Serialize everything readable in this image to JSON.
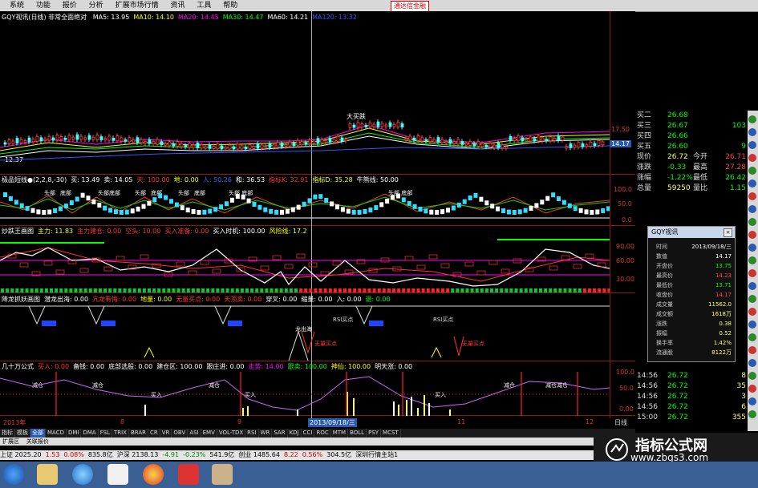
{
  "menu": {
    "items": [
      "系统",
      "功能",
      "报价",
      "分析",
      "扩展市场行情",
      "资讯",
      "工具",
      "帮助"
    ],
    "brand": "通达信金融"
  },
  "ma_panel": {
    "title": "GQY视讯(日线) 非常全面绝对",
    "labels": [
      {
        "text": "MA5: 13.95",
        "color": "#ffffff"
      },
      {
        "text": "MA10: 14.10",
        "color": "#ffff00"
      },
      {
        "text": "MA20: 14.45",
        "color": "#ff00ff"
      },
      {
        "text": "MA30: 14.47",
        "color": "#00ff00"
      },
      {
        "text": "MA60: 14.21",
        "color": "#ffffff"
      },
      {
        "text": "MA120: 13.32",
        "color": "#3355ff"
      }
    ],
    "price_low": "12.37",
    "price_mark": "17.50",
    "price_current": "14.17",
    "annot": "大买跌"
  },
  "panel2": {
    "labels": [
      {
        "text": "极品短线●(2,2,8,-30)",
        "color": "#ffffff"
      },
      {
        "text": "买: 13.49",
        "color": "#ffffff"
      },
      {
        "text": "卖: 14.05",
        "color": "#ffffff"
      },
      {
        "text": "天: 100.00",
        "color": "#ff3333"
      },
      {
        "text": "地: 0.00",
        "color": "#ffff00"
      },
      {
        "text": "人: 50.26",
        "color": "#3366ff"
      },
      {
        "text": "和: 36.53",
        "color": "#ffffff"
      },
      {
        "text": "指标K: 32.91",
        "color": "#ff3333"
      },
      {
        "text": "指标D: 35.28",
        "color": "#ffff00"
      },
      {
        "text": "牛熊线: 50.00",
        "color": "#ffffff"
      }
    ],
    "marks": [
      "头部",
      "底部",
      "头部底部",
      "头部",
      "底部",
      "头部",
      "底部",
      "头部 底部",
      "头部 底部"
    ],
    "axis": [
      "100.0",
      "50.0",
      "0.0"
    ]
  },
  "panel3": {
    "labels": [
      {
        "text": "炒跌王画图",
        "color": "#ffffff"
      },
      {
        "text": "主力: 11.83",
        "color": "#ffff00"
      },
      {
        "text": "主力建仓: 0.00",
        "color": "#ff3333"
      },
      {
        "text": "空头: 10.00",
        "color": "#ff3333"
      },
      {
        "text": "买入准备: 0.00",
        "color": "#ff3333"
      },
      {
        "text": "买入时机: 100.00",
        "color": "#ffffff"
      },
      {
        "text": "风险线: 17.2",
        "color": "#ffff00"
      }
    ],
    "axis": [
      "90.00",
      "60.00",
      "30.00"
    ]
  },
  "panel4": {
    "labels": [
      {
        "text": "降龙抓妖画图",
        "color": "#ffffff"
      },
      {
        "text": "潜龙出海: 0.00",
        "color": "#ffffff"
      },
      {
        "text": "亢龙有悔: 0.00",
        "color": "#ff3333"
      },
      {
        "text": "地量: 0.00",
        "color": "#ffff00"
      },
      {
        "text": "无量买点: 0.00",
        "color": "#ff3333"
      },
      {
        "text": "天顶卖: 0.00",
        "color": "#ff3333"
      },
      {
        "text": "穿叉: 0.00",
        "color": "#ffffff"
      },
      {
        "text": "缩量: 0.00",
        "color": "#ffffff"
      },
      {
        "text": "入: 0.00",
        "color": "#ffffff"
      },
      {
        "text": "退: 0.00",
        "color": "#00ff00"
      }
    ],
    "marks": [
      "龙出海",
      "RSI买点",
      "RSI买点",
      "无量买点",
      "无量买点"
    ]
  },
  "panel5": {
    "labels": [
      {
        "text": "几十万公式",
        "color": "#ffffff"
      },
      {
        "text": "买入: 0.00",
        "color": "#ff3333"
      },
      {
        "text": "备钱: 0.00",
        "color": "#ffffff"
      },
      {
        "text": "底部选股: 0.00",
        "color": "#ffffff"
      },
      {
        "text": "建仓区: 100.00",
        "color": "#ffffff"
      },
      {
        "text": "跟庄进: 0.00",
        "color": "#ffffff"
      },
      {
        "text": "走势: 14.00",
        "color": "#ff00ff"
      },
      {
        "text": "跟卖: 100.00",
        "color": "#00ff00"
      },
      {
        "text": "神仙: 100.00",
        "color": "#ffff00"
      },
      {
        "text": "明天涨: 0.00",
        "color": "#ffffff"
      }
    ],
    "marks": [
      "减仓",
      "减仓",
      "减仓",
      "买入",
      "买入",
      "买入",
      "减仓",
      "减仓减仓"
    ],
    "axis": [
      "100.0",
      "50.0",
      "0.00"
    ]
  },
  "date_axis": {
    "left": "2013年",
    "mid1": "8",
    "mid2": "9",
    "sel": "2013/09/18/三",
    "r1": "11",
    "r2": "12",
    "period": "日线"
  },
  "tabs": [
    "指标",
    "模板",
    "全部",
    "MACD",
    "DMI",
    "DMA",
    "FSL",
    "TRIX",
    "BRAR",
    "CR",
    "VR",
    "OBV",
    "ASI",
    "EMV",
    "VOL-TDX",
    "RSI",
    "WR",
    "SAR",
    "KDJ",
    "CCI",
    "ROC",
    "MTM",
    "BOLL",
    "PSY",
    "MCST"
  ],
  "tabs2": [
    "扩展区",
    "关联报价"
  ],
  "quote": {
    "rows": [
      {
        "l": "买二",
        "v": "26.68",
        "r": ""
      },
      {
        "l": "买三",
        "v": "26.67",
        "r": "103"
      },
      {
        "l": "买四",
        "v": "26.66",
        "r": ""
      },
      {
        "l": "买五",
        "v": "26.60",
        "r": "9"
      },
      {
        "l": "现价",
        "v": "26.72",
        "m": "今开",
        "r": "26.71"
      },
      {
        "l": "涨跌",
        "v": "-0.33",
        "m": "最高",
        "r": "27.28"
      },
      {
        "l": "涨幅",
        "v": "-1.22%",
        "m": "最低",
        "r": "26.42"
      },
      {
        "l": "总量",
        "v": "59250",
        "m": "量比",
        "r": "1.15"
      }
    ],
    "ticks": [
      {
        "t": "14:56",
        "p": "26.72",
        "v": "8"
      },
      {
        "t": "14:56",
        "p": "26.72",
        "v": "35"
      },
      {
        "t": "14:56",
        "p": "26.72",
        "v": "3"
      },
      {
        "t": "14:56",
        "p": "26.72",
        "v": "6"
      },
      {
        "t": "15:00",
        "p": "26.72",
        "v": "355"
      }
    ]
  },
  "popup": {
    "title": "GQY视讯",
    "rows": [
      {
        "l": "时间",
        "v": "2013/09/18/三"
      },
      {
        "l": "数值",
        "v": "14.17"
      },
      {
        "l": "开盘价",
        "v": "13.75"
      },
      {
        "l": "最高价",
        "v": "14.23"
      },
      {
        "l": "最低价",
        "v": "13.71"
      },
      {
        "l": "收盘价",
        "v": "14.17"
      },
      {
        "l": "成交量",
        "v": "11562.0"
      },
      {
        "l": "成交额",
        "v": "1618万"
      },
      {
        "l": "涨跌",
        "v": "0.38"
      },
      {
        "l": "振幅",
        "v": "0.52"
      },
      {
        "l": "换手率",
        "v": "1.42%"
      },
      {
        "l": "流通股",
        "v": "8122万"
      }
    ]
  },
  "status": [
    {
      "text": "上证 2025.20",
      "color": "#000000"
    },
    {
      "text": "1.53",
      "color": "#d00000"
    },
    {
      "text": "0.08%",
      "color": "#d00000"
    },
    {
      "text": "835.8亿",
      "color": "#000000"
    },
    {
      "text": "沪深 2138.13",
      "color": "#000000"
    },
    {
      "text": "-4.91",
      "color": "#008800"
    },
    {
      "text": "-0.23%",
      "color": "#008800"
    },
    {
      "text": "541.9亿",
      "color": "#000000"
    },
    {
      "text": "创业 1485.64",
      "color": "#000000"
    },
    {
      "text": "8.22",
      "color": "#d00000"
    },
    {
      "text": "0.56%",
      "color": "#d00000"
    },
    {
      "text": "304.5亿",
      "color": "#000000"
    },
    {
      "text": "深圳行情主站1",
      "color": "#000000"
    }
  ],
  "watermark": {
    "title": "指标公式网",
    "url": "www.zbgs3.com"
  }
}
